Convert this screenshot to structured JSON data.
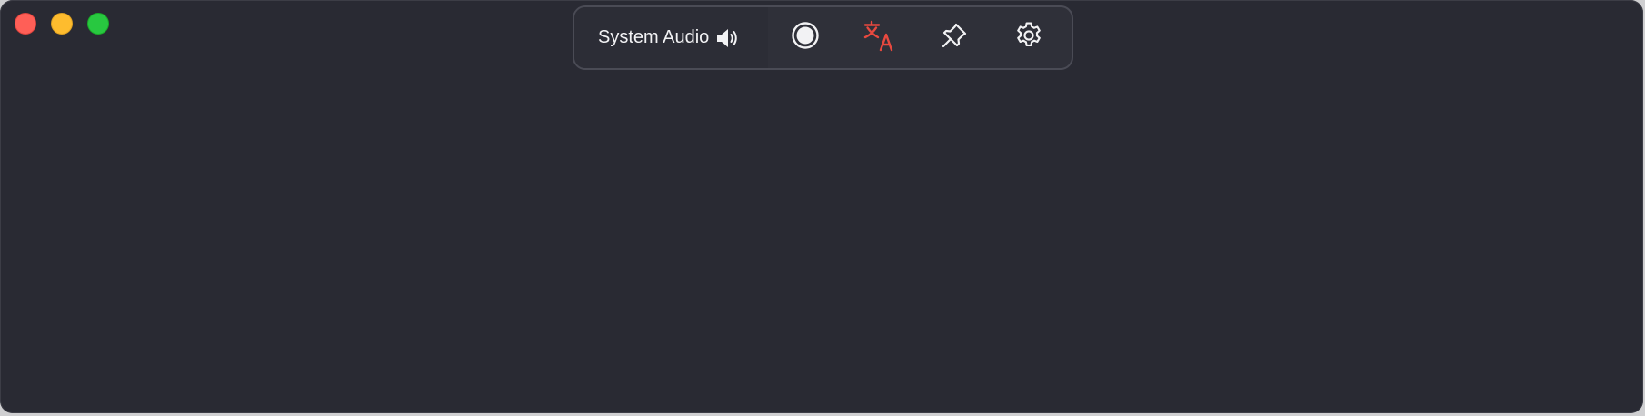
{
  "window": {
    "controls": [
      "close",
      "minimize",
      "zoom"
    ]
  },
  "toolbar": {
    "audio_source_label": "System Audio",
    "icons": {
      "speaker": "speaker-icon",
      "record": "record-icon",
      "translate": "translate-icon",
      "pin": "pin-icon",
      "settings": "gear-icon"
    }
  },
  "colors": {
    "window_background": "#292a33",
    "toolbar_background": "#2f3039",
    "translate_accent": "#e8493f",
    "close": "#ff5f57",
    "minimize": "#febc2e",
    "zoom": "#28c840"
  }
}
